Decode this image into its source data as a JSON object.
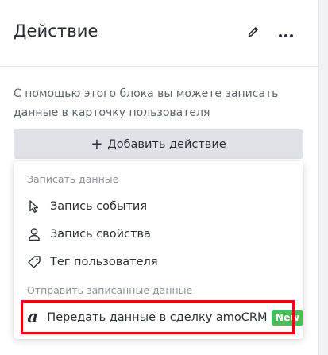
{
  "header": {
    "title": "Действие",
    "edit_icon": "pencil-icon",
    "more_icon": "more-horizontal-icon"
  },
  "description": "С помощью этого блока вы можете записать данные в карточку пользователя",
  "add_button": {
    "icon": "plus-icon",
    "label": "Добавить действие"
  },
  "dropdown": {
    "groups": [
      {
        "label": "Записать данные",
        "items": [
          {
            "icon": "cursor-icon",
            "label": "Запись события"
          },
          {
            "icon": "user-icon",
            "label": "Запись свойства"
          },
          {
            "icon": "tag-icon",
            "label": "Тег пользователя"
          }
        ]
      },
      {
        "label": "Отправить записанные данные",
        "items": [
          {
            "icon": "amocrm-icon",
            "label": "Передать данные в сделку amoCRM",
            "badge": "New",
            "highlighted": true
          }
        ]
      }
    ]
  },
  "colors": {
    "highlight_border": "#e3061a",
    "badge_bg": "#4bbd5a",
    "add_button_bg": "#dfe2e6"
  }
}
